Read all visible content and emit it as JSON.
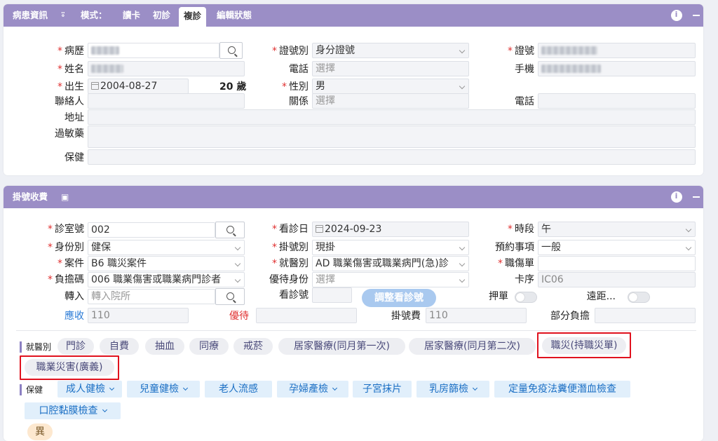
{
  "patient": {
    "header": {
      "title": "病患資訊",
      "mode_label": "模式：",
      "tabs": [
        "讀卡",
        "初診",
        "複診",
        "編輯狀態"
      ],
      "active_tab": "複診"
    },
    "labels": {
      "record": "病歷",
      "id_type": "證號別",
      "id_no": "證號",
      "name": "姓名",
      "phone": "電話",
      "mobile": "手機",
      "birth": "出生",
      "gender": "性別",
      "contact": "聯絡人",
      "relation": "關係",
      "contact_phone": "電話",
      "address": "地址",
      "allergy": "過敏藥",
      "insurance": "保健"
    },
    "values": {
      "id_type": "身分證號",
      "phone_placeholder": "選擇",
      "birth": "2004-08-27",
      "age": "20 歲",
      "gender": "男",
      "relation_placeholder": "選擇"
    }
  },
  "registration": {
    "header": {
      "title": "掛號收費"
    },
    "labels": {
      "clinic_no": "診室號",
      "visit_date": "看診日",
      "period": "時段",
      "identity": "身份別",
      "reg_type": "掛號別",
      "reservation": "預約事項",
      "case": "案件",
      "visit_type": "就醫別",
      "injury_no": "職傷單",
      "copay_code": "負擔碼",
      "special_identity": "優待身份",
      "card_seq": "卡序",
      "transfer": "轉入",
      "visit_no": "看診號",
      "deposit": "押單",
      "remote": "遠距...",
      "receivable": "應收",
      "discount": "優待",
      "reg_fee": "掛號費",
      "partial_copay": "部分負擔"
    },
    "values": {
      "clinic_no": "002",
      "visit_date": "2024-09-23",
      "period": "午",
      "identity": "健保",
      "reg_type": "現掛",
      "reservation": "一般",
      "case": "B6 職災案件",
      "visit_type": "AD 職業傷害或職業病門(急)診",
      "copay_code": "006 職業傷害或職業病門診者",
      "special_identity_placeholder": "選擇",
      "card_seq": "IC06",
      "transfer_placeholder": "轉入院所",
      "adjust_button": "調整看診號",
      "receivable": "110",
      "reg_fee": "110"
    },
    "visit_section": {
      "title": "就醫別",
      "chips": [
        "門診",
        "自費",
        "抽血",
        "同療",
        "戒菸",
        "居家醫療(同月第一次)",
        "居家醫療(同月第二次)",
        "職災(持職災單)",
        "職業災害(廣義)"
      ]
    },
    "health_section": {
      "title": "保健",
      "chips": [
        "成人健檢",
        "兒童健檢",
        "老人流感",
        "孕婦產檢",
        "子宮抹片",
        "乳房篩檢",
        "定量免疫法糞便潛血檢查",
        "口腔黏膜檢查"
      ]
    },
    "abnormal_chip": "異"
  },
  "colors": {
    "header": "#9b8ec6",
    "required": "#e03030",
    "highlight": "#e0121e",
    "link_blue": "#2b7bd6"
  }
}
